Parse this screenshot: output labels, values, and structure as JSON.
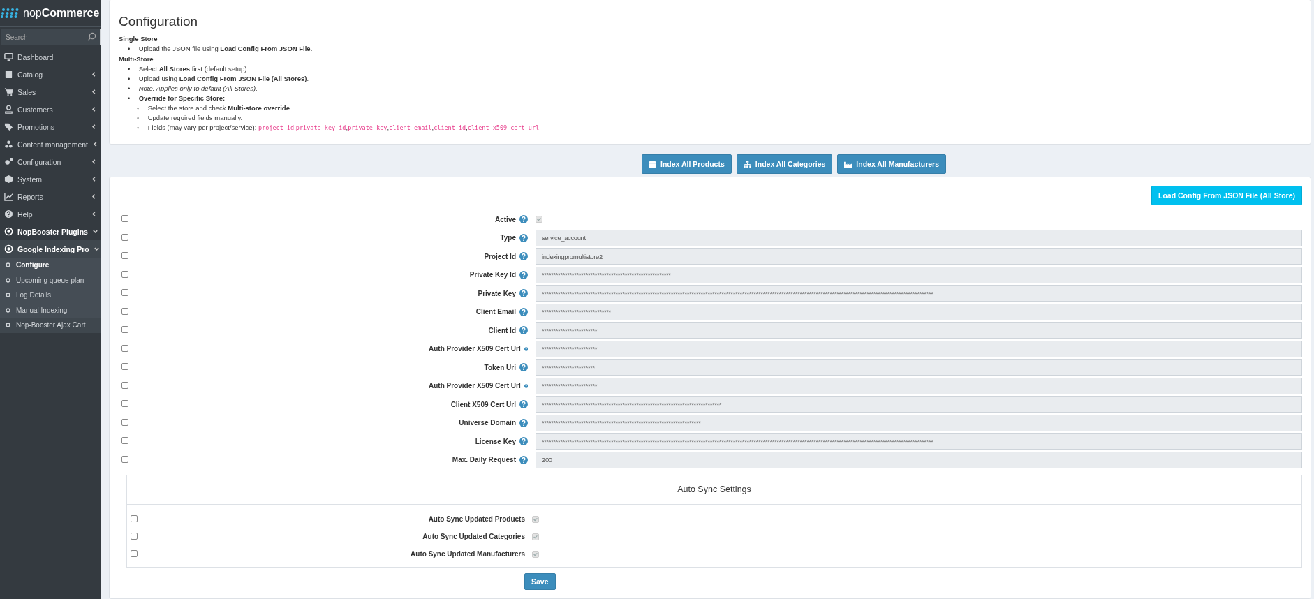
{
  "sidebar": {
    "logo": {
      "prefix": "nop",
      "name": "Commerce"
    },
    "search": {
      "placeholder": "Search"
    },
    "items": [
      {
        "label": "Dashboard",
        "kind": "link"
      },
      {
        "label": "Catalog",
        "kind": "group",
        "expanded": false
      },
      {
        "label": "Sales",
        "kind": "group",
        "expanded": false
      },
      {
        "label": "Customers",
        "kind": "group",
        "expanded": false
      },
      {
        "label": "Promotions",
        "kind": "group",
        "expanded": false
      },
      {
        "label": "Content management",
        "kind": "group",
        "expanded": false
      },
      {
        "label": "Configuration",
        "kind": "group",
        "expanded": false
      },
      {
        "label": "System",
        "kind": "group",
        "expanded": false
      },
      {
        "label": "Reports",
        "kind": "group",
        "expanded": false
      },
      {
        "label": "Help",
        "kind": "group",
        "expanded": false
      },
      {
        "label": "NopBooster Plugins",
        "kind": "group",
        "expanded": true,
        "children": [
          {
            "label": "Google Indexing Pro",
            "kind": "group",
            "expanded": true,
            "children": [
              {
                "label": "Configure",
                "selected": true
              },
              {
                "label": "Upcoming queue plan",
                "selected": false
              },
              {
                "label": "Log Details",
                "selected": false
              },
              {
                "label": "Manual Indexing",
                "selected": false
              }
            ]
          },
          {
            "label": "Nop-Booster Ajax Cart",
            "kind": "link"
          }
        ]
      }
    ]
  },
  "intro": {
    "title": "Configuration",
    "sections": [
      {
        "heading": "Single Store",
        "bullets": [
          {
            "marker": "•",
            "text": "Upload the JSON file using **Load Config From JSON File**.",
            "italic": false
          }
        ]
      },
      {
        "heading": "Multi-Store",
        "bullets": [
          {
            "marker": "•",
            "text": "Select **All Stores** first (default setup).",
            "italic": false
          },
          {
            "marker": "•",
            "text": "Upload using **Load Config From JSON File (All Stores)**.",
            "italic": false
          },
          {
            "marker": "•",
            "text": "Note: Applies only to default (All Stores).",
            "italic": true
          },
          {
            "marker": "•",
            "text": "**Override for Specific Store:**",
            "italic": false,
            "sub": [
              {
                "marker": "◦",
                "text": "Select the store and check **Multi-store override**."
              },
              {
                "marker": "◦",
                "text": "Update required fields manually."
              },
              {
                "marker": "◦",
                "text": "Fields (may vary per project/service):",
                "fields": [
                  {
                    "code": "project_id",
                    "sep": ","
                  },
                  {
                    "code": "private_key_id",
                    "sep": ","
                  },
                  {
                    "code": "private_key",
                    "sep": ","
                  },
                  {
                    "code": "client_email",
                    "sep": ","
                  },
                  {
                    "code": "client_id",
                    "sep": ","
                  },
                  {
                    "code": "client_x509_cert_url"
                  }
                ]
              }
            ]
          }
        ]
      }
    ]
  },
  "actions": [
    "Index All Products",
    "Index All Categories",
    "Index All Manufacturers"
  ],
  "load_button": "Load Config From JSON File (All Store)",
  "fields": [
    {
      "label": "Active",
      "kind": "checkbox",
      "checked": true,
      "override": false
    },
    {
      "label": "Type",
      "kind": "text",
      "value": "service_account",
      "override": false
    },
    {
      "label": "Project Id",
      "kind": "text",
      "value": "indexingpromultistore2",
      "override": false
    },
    {
      "label": "Private Key Id",
      "kind": "text",
      "value": "********************************************************",
      "override": false
    },
    {
      "label": "Private Key",
      "kind": "text",
      "value": "**************************************************************************************************************************************************************************",
      "override": false
    },
    {
      "label": "Client Email",
      "kind": "text",
      "value": "******************************",
      "override": false
    },
    {
      "label": "Client Id",
      "kind": "text",
      "value": "************************",
      "override": false
    },
    {
      "label": "Auth Provider X509 Cert Url",
      "kind": "text",
      "value": "************************",
      "override": false
    },
    {
      "label": "Token Uri",
      "kind": "text",
      "value": "***********************",
      "override": false
    },
    {
      "label": "Auth Provider X509 Cert Url",
      "kind": "text",
      "value": "************************",
      "override": false
    },
    {
      "label": "Client X509 Cert Url",
      "kind": "text",
      "value": "******************************************************************************",
      "override": false
    },
    {
      "label": "Universe Domain",
      "kind": "text",
      "value": "*********************************************************************",
      "override": false
    },
    {
      "label": "License Key",
      "kind": "text",
      "value": "**************************************************************************************************************************************************************************",
      "override": false
    },
    {
      "label": "Max. Daily Request",
      "kind": "text",
      "value": "200",
      "override": false
    }
  ],
  "auto_sync": {
    "title": "Auto Sync Settings",
    "options": [
      {
        "label": "Auto Sync Updated Products",
        "checked": true,
        "override": false
      },
      {
        "label": "Auto Sync Updated Categories",
        "checked": true,
        "override": false
      },
      {
        "label": "Auto Sync Updated Manufacturers",
        "checked": true,
        "override": false
      }
    ]
  },
  "save_button": "Save"
}
